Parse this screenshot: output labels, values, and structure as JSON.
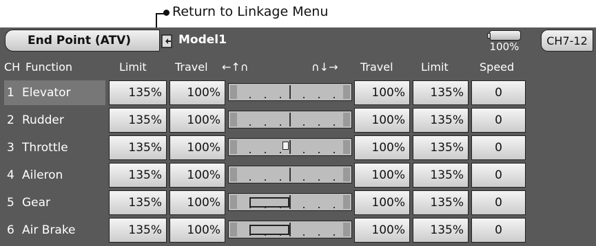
{
  "annotation": {
    "text": "Return to Linkage Menu"
  },
  "header": {
    "title": "End Point (ATV)",
    "model": "Model1",
    "battery_pct": "100%",
    "channel_page": "CH7-12"
  },
  "columns": {
    "ch": "CH",
    "function": "Function",
    "limit_left": "Limit",
    "travel_left": "Travel",
    "arrows_left": "←↑∩",
    "arrows_right": "∩↓→",
    "travel_right": "Travel",
    "limit_right": "Limit",
    "speed": "Speed"
  },
  "rows": [
    {
      "ch": "1",
      "function": "Elevator",
      "limit_left": "135%",
      "travel_left": "100%",
      "travel_right": "100%",
      "limit_right": "135%",
      "speed": "0",
      "indicator": "none"
    },
    {
      "ch": "2",
      "function": "Rudder",
      "limit_left": "135%",
      "travel_left": "100%",
      "travel_right": "100%",
      "limit_right": "135%",
      "speed": "0",
      "indicator": "none"
    },
    {
      "ch": "3",
      "function": "Throttle",
      "limit_left": "135%",
      "travel_left": "100%",
      "travel_right": "100%",
      "limit_right": "135%",
      "speed": "0",
      "indicator": "cursor"
    },
    {
      "ch": "4",
      "function": "Aileron",
      "limit_left": "135%",
      "travel_left": "100%",
      "travel_right": "100%",
      "limit_right": "135%",
      "speed": "0",
      "indicator": "none"
    },
    {
      "ch": "5",
      "function": "Gear",
      "limit_left": "135%",
      "travel_left": "100%",
      "travel_right": "100%",
      "limit_right": "135%",
      "speed": "0",
      "indicator": "range"
    },
    {
      "ch": "6",
      "function": "Air Brake",
      "limit_left": "135%",
      "travel_left": "100%",
      "travel_right": "100%",
      "limit_right": "135%",
      "speed": "0",
      "indicator": "range"
    }
  ],
  "colors": {
    "screen_bg": "#595959",
    "button_bg": "#e0e0e0",
    "selected_row": "#777777"
  }
}
